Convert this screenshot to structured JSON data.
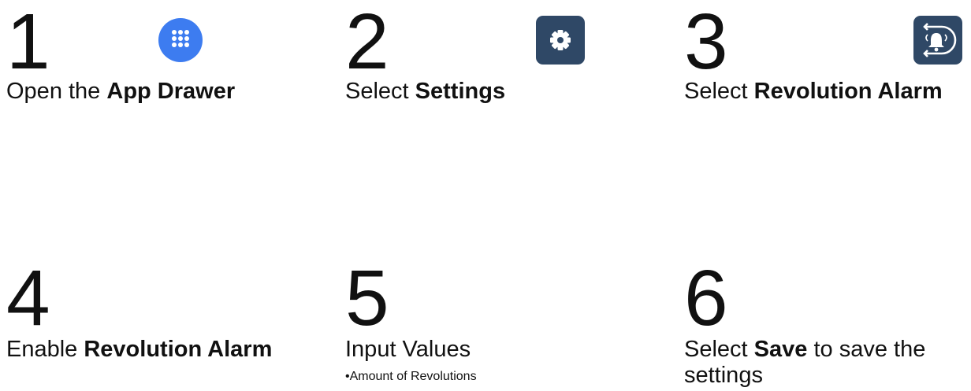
{
  "steps": [
    {
      "number": "1",
      "text_plain": "Open the ",
      "text_bold": "App Drawer",
      "text_after": "",
      "icon": "apps-grid-icon"
    },
    {
      "number": "2",
      "text_plain": "Select ",
      "text_bold": "Settings",
      "text_after": "",
      "icon": "gear-icon"
    },
    {
      "number": "3",
      "text_plain": "Select ",
      "text_bold": "Revolution Alarm",
      "text_after": "",
      "icon": "revolution-alarm-icon"
    },
    {
      "number": "4",
      "text_plain": "Enable ",
      "text_bold": "Revolution Alarm",
      "text_after": ""
    },
    {
      "number": "5",
      "text_plain": "Input Values",
      "text_bold": "",
      "text_after": "",
      "bullet": "•Amount of Revolutions"
    },
    {
      "number": "6",
      "text_plain": "Select ",
      "text_bold": "Save",
      "text_after": " to save the",
      "text_line2": "settings"
    }
  ],
  "colors": {
    "apps_icon_bg": "#3d7cf0",
    "settings_icon_bg": "#2f4866"
  }
}
